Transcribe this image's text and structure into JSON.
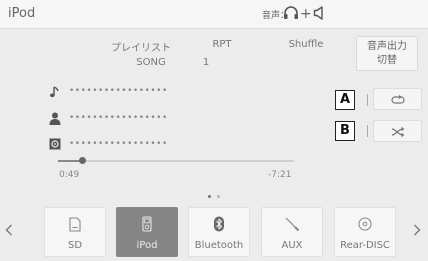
{
  "header": {
    "title": "iPod",
    "audio_status_label": "音声：",
    "audio_output_icons": [
      "headphones-icon",
      "speaker-icon"
    ],
    "audio_output_separator": "+"
  },
  "columns": {
    "playlist_label": "プレイリスト",
    "rpt_label": "RPT",
    "shuffle_label": "Shuffle"
  },
  "values": {
    "playlist_value": "SONG",
    "rpt_value": "1"
  },
  "output_switch_button": {
    "line1": "音声出力",
    "line2": "切替"
  },
  "track_info": [
    {
      "icon": "music-note-icon",
      "text": "•••••••••••••••••"
    },
    {
      "icon": "artist-icon",
      "text": "•••••••••••••••••"
    },
    {
      "icon": "album-icon",
      "text": "•••••••••••••••••"
    }
  ],
  "callouts": {
    "a": "A",
    "b": "B"
  },
  "controls": {
    "repeat_icon": "repeat-icon",
    "shuffle_icon": "shuffle-icon"
  },
  "playback": {
    "elapsed": "0:49",
    "remaining": "-7:21",
    "progress_fraction": 0.1
  },
  "pager": {
    "page_count": 2,
    "active_page": 1
  },
  "sources": [
    {
      "label": "SD",
      "icon": "sd-card-icon",
      "active": false
    },
    {
      "label": "iPod",
      "icon": "ipod-icon",
      "active": true
    },
    {
      "label": "Bluetooth",
      "icon": "bluetooth-icon",
      "active": false
    },
    {
      "label": "AUX",
      "icon": "aux-cable-icon",
      "active": false
    },
    {
      "label": "Rear-DISC",
      "icon": "disc-icon",
      "active": false
    }
  ],
  "navigation": {
    "prev_icon": "chevron-left-icon",
    "next_icon": "chevron-right-icon"
  },
  "colors": {
    "background": "#ececec",
    "active_source": "#868686",
    "text": "#777777"
  }
}
